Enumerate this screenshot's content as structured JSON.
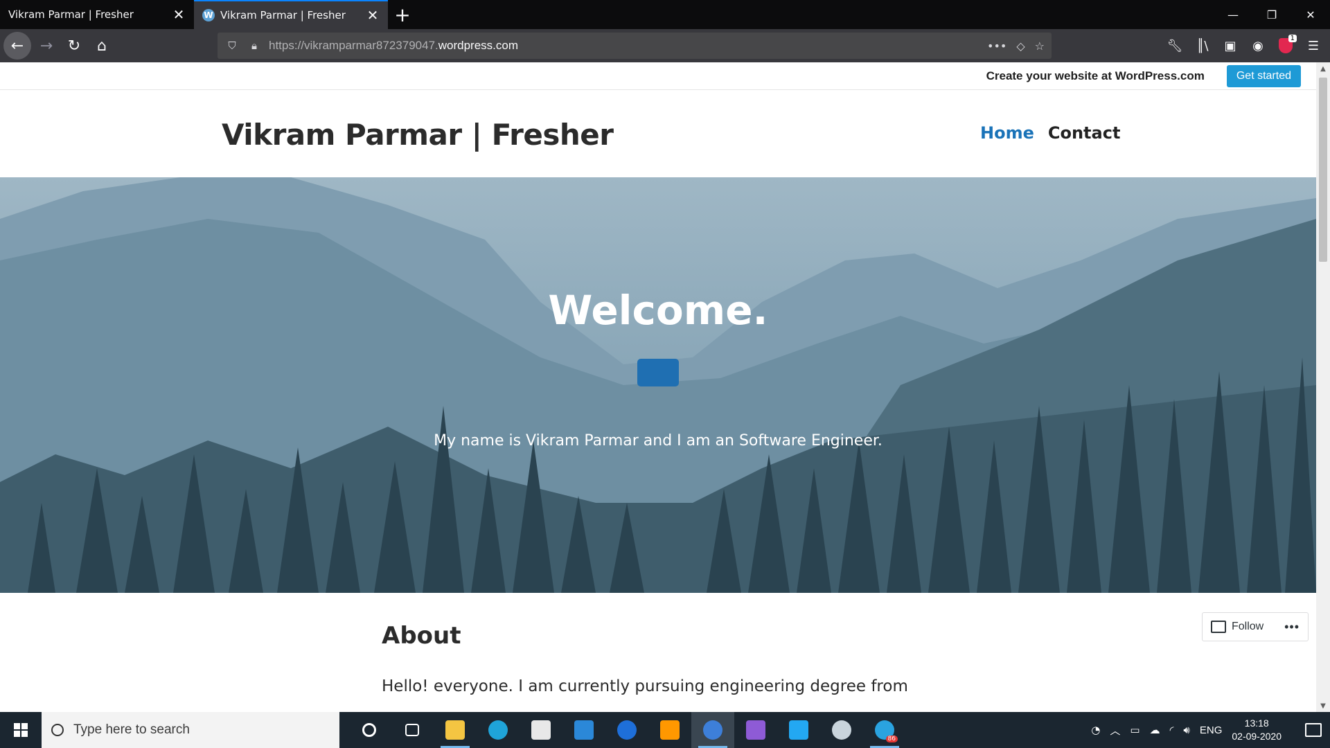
{
  "browser": {
    "tabs": [
      {
        "title": "Vikram Parmar | Fresher",
        "active": false
      },
      {
        "title": "Vikram Parmar | Fresher",
        "active": true
      }
    ],
    "url_prefix": "https://vikramparmar872379047.",
    "url_domain": "wordpress.com",
    "extension_badge": "1"
  },
  "wpbar": {
    "text": "Create your website at WordPress.com",
    "button": "Get started"
  },
  "site": {
    "title": "Vikram Parmar | Fresher",
    "nav": [
      "Home",
      "Contact"
    ]
  },
  "hero": {
    "title": "Welcome.",
    "subtitle": "My name is Vikram Parmar and I am an Software Engineer."
  },
  "about": {
    "title": "About",
    "text": "Hello! everyone. I am currently pursuing engineering degree from"
  },
  "follow": {
    "label": "Follow",
    "more": "•••"
  },
  "taskbar": {
    "search_placeholder": "Type here to search",
    "language": "ENG",
    "time": "13:18",
    "date": "02-09-2020",
    "telegram_badge": "86"
  },
  "colors": {
    "accent": "#0a84ff",
    "wp_button": "#1e9ad6",
    "nav_active": "#1a73b8",
    "hero_button": "#1f6fb2"
  }
}
